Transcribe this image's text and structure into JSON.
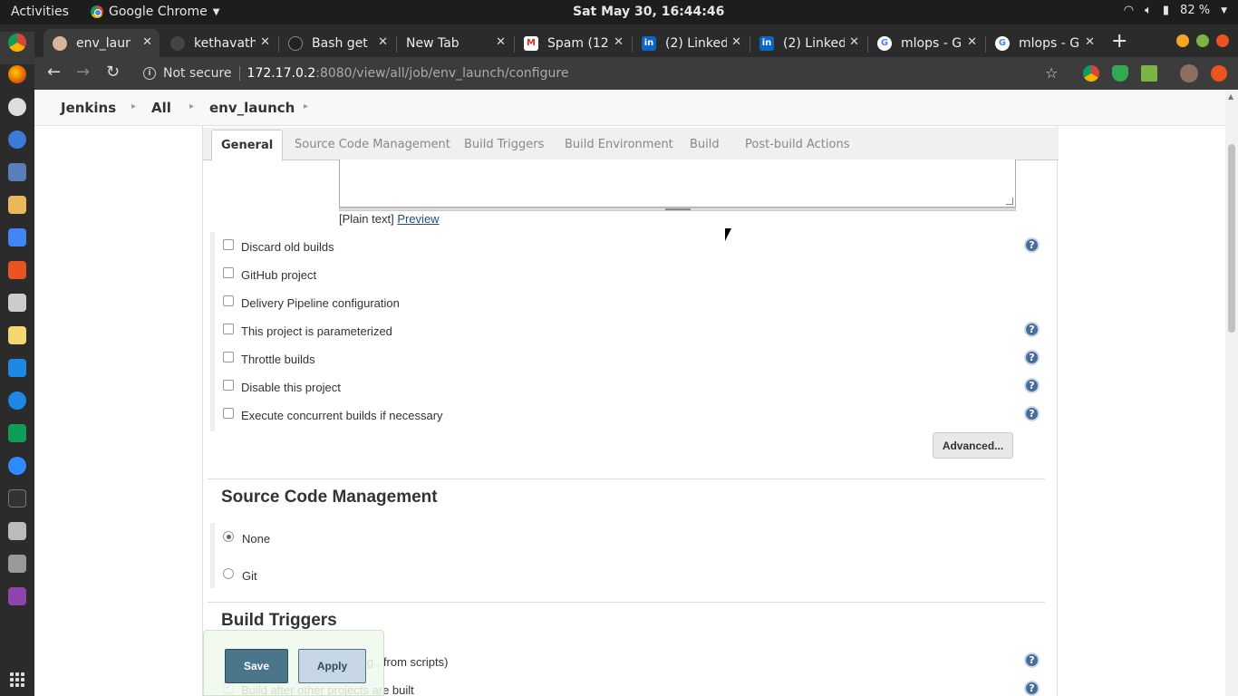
{
  "desktop": {
    "activities": "Activities",
    "app_name": "Google Chrome",
    "clock": "Sat May 30, 16:44:46",
    "battery": "82 %"
  },
  "tabs": [
    {
      "label": "env_launch",
      "icon": "jenkins-favicon"
    },
    {
      "label": "kethavath",
      "icon": "github-favicon"
    },
    {
      "label": "Bash get",
      "icon": "bash-favicon"
    },
    {
      "label": "New Tab",
      "icon": ""
    },
    {
      "label": "Spam (12",
      "icon": "gmail-favicon"
    },
    {
      "label": "(2) Linked",
      "icon": "linkedin-favicon"
    },
    {
      "label": "(2) Linked",
      "icon": "linkedin-favicon"
    },
    {
      "label": "mlops - G",
      "icon": "google-favicon"
    },
    {
      "label": "mlops - G",
      "icon": "google-favicon"
    }
  ],
  "address_bar": {
    "security": "Not secure",
    "host": "172.17.0.2",
    "rest": ":8080/view/all/job/env_launch/configure"
  },
  "breadcrumbs": [
    "Jenkins",
    "All",
    "env_launch"
  ],
  "config_tabs": [
    "General",
    "Source Code Management",
    "Build Triggers",
    "Build Environment",
    "Build",
    "Post-build Actions"
  ],
  "description": {
    "plain_text": "[Plain text]",
    "preview_link": "Preview"
  },
  "general_options": [
    {
      "label": "Discard old builds",
      "checked": false,
      "help": true
    },
    {
      "label": "GitHub project",
      "checked": false,
      "help": false
    },
    {
      "label": "Delivery Pipeline configuration",
      "checked": false,
      "help": false
    },
    {
      "label": "This project is parameterized",
      "checked": false,
      "help": true
    },
    {
      "label": "Throttle builds",
      "checked": false,
      "help": true
    },
    {
      "label": "Disable this project",
      "checked": false,
      "help": true
    },
    {
      "label": "Execute concurrent builds if necessary",
      "checked": false,
      "help": true
    }
  ],
  "advanced_button": "Advanced...",
  "scm": {
    "title": "Source Code Management",
    "options": [
      {
        "label": "None",
        "selected": true
      },
      {
        "label": "Git",
        "selected": false
      }
    ]
  },
  "build_triggers": {
    "title": "Build Triggers",
    "options": [
      {
        "label": "Trigger builds remotely (e.g., from scripts)",
        "visible_label": "e.g., from scripts)",
        "checked": false
      },
      {
        "label": "Build after other projects are built",
        "checked": true
      }
    ]
  },
  "actions": {
    "save": "Save",
    "apply": "Apply"
  },
  "help_symbol": "?",
  "colors": {
    "save_button": "#4b758b",
    "apply_button": "#c7d7e8",
    "help_icon": "#4a6c9b"
  }
}
